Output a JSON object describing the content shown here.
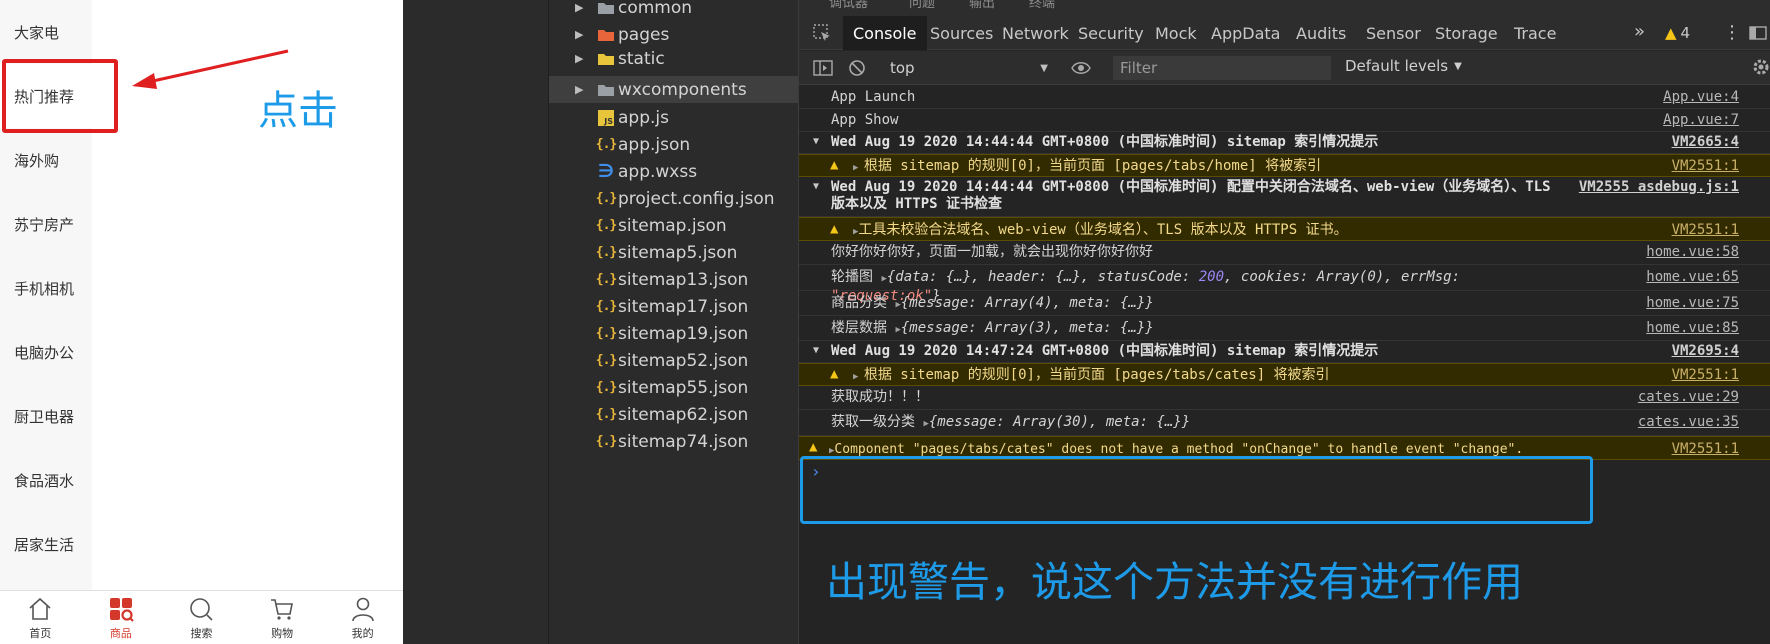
{
  "phone": {
    "categories": [
      "大家电",
      "热门推荐",
      "海外购",
      "苏宁房产",
      "手机相机",
      "电脑办公",
      "厨卫电器",
      "食品酒水",
      "居家生活"
    ],
    "annotation_click": "点击",
    "tabbar": [
      "首页",
      "商品",
      "搜索",
      "购物",
      "我的"
    ],
    "accent_color": "#d4382b"
  },
  "file_tree": {
    "items": [
      "common",
      "pages",
      "static",
      "wxcomponents",
      "app.js",
      "app.json",
      "app.wxss",
      "project.config.json",
      "sitemap.json",
      "sitemap5.json",
      "sitemap13.json",
      "sitemap17.json",
      "sitemap19.json",
      "sitemap52.json",
      "sitemap55.json",
      "sitemap62.json",
      "sitemap74.json"
    ]
  },
  "devtools": {
    "tabs": [
      "Console",
      "Sources",
      "Network",
      "Security",
      "Mock",
      "AppData",
      "Audits",
      "Sensor",
      "Storage",
      "Trace"
    ],
    "top_cut": [
      "调试器",
      "问题",
      "输出",
      "终端"
    ],
    "warning_count": "4",
    "context": "top",
    "filter_placeholder": "Filter",
    "levels": "Default levels",
    "logs": [
      {
        "msg": "App Launch",
        "src": "App.vue:4"
      },
      {
        "msg": "App Show",
        "src": "App.vue:7"
      },
      {
        "msg": "Wed Aug 19 2020 14:44:44 GMT+0800 (中国标准时间) sitemap 索引情况提示",
        "src": "VM2665:4"
      },
      {
        "msg": "根据 sitemap 的规则[0]，当前页面 [pages/tabs/home] 将被索引",
        "src": "VM2551:1"
      },
      {
        "msg": "Wed Aug 19 2020 14:44:44 GMT+0800 (中国标准时间) 配置中关闭合法域名、web-view（业务域名）、TLS 版本以及 HTTPS 证书检查",
        "src": "VM2555 asdebug.js:1"
      },
      {
        "msg": "工具未校验合法域名、web-view（业务域名）、TLS 版本以及 HTTPS 证书。",
        "src": "VM2551:1"
      },
      {
        "msg": "你好你好你好，页面一加载，就会出现你好你好你好",
        "src": "home.vue:58"
      },
      {
        "label": "轮播图",
        "obj": "{data: {…}, header: {…}, statusCode: ",
        "num": "200",
        "obj2": ", cookies: Array(0), errMsg: ",
        "str": "\"request:ok\"",
        "obj3": "}",
        "src": "home.vue:65"
      },
      {
        "label": "商品分类",
        "obj": "{message: Array(4), meta: {…}}",
        "src": "home.vue:75"
      },
      {
        "label": "楼层数据",
        "obj": "{message: Array(3), meta: {…}}",
        "src": "home.vue:85"
      },
      {
        "msg": "Wed Aug 19 2020 14:47:24 GMT+0800 (中国标准时间) sitemap 索引情况提示",
        "src": "VM2695:4"
      },
      {
        "msg": "根据 sitemap 的规则[0]，当前页面 [pages/tabs/cates] 将被索引",
        "src": "VM2551:1"
      },
      {
        "msg": "获取成功！！！",
        "src": "cates.vue:29"
      },
      {
        "label": "获取一级分类",
        "obj": "{message: Array(30), meta: {…}}",
        "src": "cates.vue:35"
      },
      {
        "msg": "Component \"pages/tabs/cates\" does not have a method \"onChange\" to handle event \"change\".",
        "src": "VM2551:1"
      }
    ],
    "prompt": "›",
    "annotation_warning": "出现警告，说这个方法并没有进行作用"
  }
}
